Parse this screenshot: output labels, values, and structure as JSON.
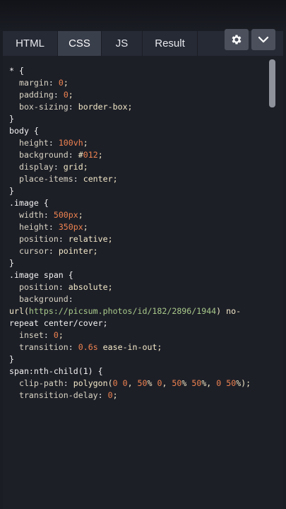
{
  "tabs": [
    {
      "label": "HTML"
    },
    {
      "label": "CSS"
    },
    {
      "label": "JS"
    },
    {
      "label": "Result"
    }
  ],
  "active_tab": "CSS",
  "icons": {
    "settings": "gear-icon",
    "toggle": "chevron-down-icon"
  },
  "code_lines": [
    "* {",
    "  margin: 0;",
    "  padding: 0;",
    "  box-sizing: border-box;",
    "}",
    "body {",
    "  height: 100vh;",
    "  background: #012;",
    "  display: grid;",
    "  place-items: center;",
    "}",
    ".image {",
    "  width: 500px;",
    "  height: 350px;",
    "  position: relative;",
    "  cursor: pointer;",
    "}",
    ".image span {",
    "  position: absolute;",
    "  background:",
    "url(https://picsum.photos/id/182/2896/1944) no-",
    "repeat center/cover;",
    "  inset: 0;",
    "  transition: 0.6s ease-in-out;",
    "}",
    "span:nth-child(1) {",
    "  clip-path: polygon(0 0, 50% 0, 50% 50%, 0 50%);",
    "  transition-delay: 0;"
  ],
  "colors": {
    "background": "#1b1d24",
    "editor": "#1d1f27",
    "tab": "#262a35",
    "active_tab": "#3a3f4c",
    "number": "#ef8350",
    "url": "#a8c98a"
  }
}
